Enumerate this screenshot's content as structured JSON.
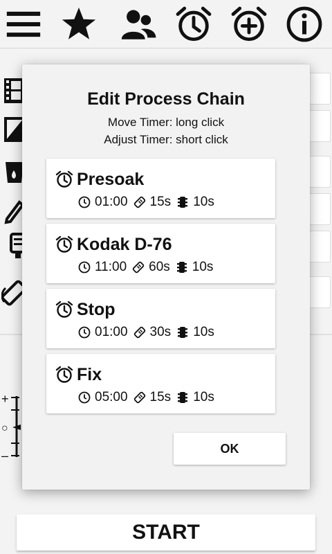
{
  "toolbar": {
    "icons": [
      "menu-icon",
      "star-icon",
      "people-icon",
      "alarm-icon",
      "add-alarm-icon",
      "info-icon"
    ]
  },
  "main": {
    "start_label": "START",
    "side_icons": [
      "film-icon",
      "exposure-icon",
      "developer-tank-icon",
      "pen-icon",
      "agitation-icon",
      "rotate-icon"
    ],
    "scale_labels": [
      "+",
      "○",
      "–"
    ]
  },
  "dialog": {
    "title": "Edit Process Chain",
    "hint_move": "Move Timer: long click",
    "hint_adjust": "Adjust Timer: short click",
    "ok_label": "OK",
    "steps": [
      {
        "name": "Presoak",
        "time": "01:00",
        "agitation": "15s",
        "drain": "10s"
      },
      {
        "name": "Kodak D-76",
        "time": "11:00",
        "agitation": "60s",
        "drain": "10s"
      },
      {
        "name": "Stop",
        "time": "01:00",
        "agitation": "30s",
        "drain": "10s"
      },
      {
        "name": "Fix",
        "time": "05:00",
        "agitation": "15s",
        "drain": "10s"
      }
    ]
  },
  "colors": {
    "background": "#f3f3f3",
    "card": "#ffffff",
    "text": "#111111"
  }
}
